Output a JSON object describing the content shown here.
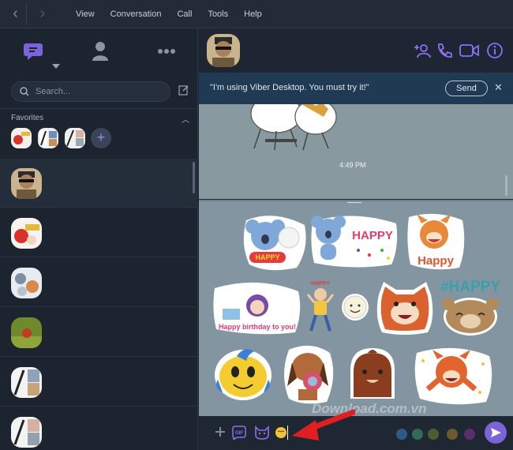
{
  "menu": [
    "View",
    "Conversation",
    "Call",
    "Tools",
    "Help"
  ],
  "sidebar": {
    "search": {
      "placeholder": "Search..."
    },
    "favorites_label": "Favorites",
    "fav_add_label": "+"
  },
  "banner": {
    "text": "\"I'm using Viber Desktop. You must try it!\"",
    "send_label": "Send",
    "close_label": "✕"
  },
  "messages": {
    "time": "4:49 PM"
  },
  "input_bar": {
    "gif_label": "GIF"
  },
  "stickers": [
    {
      "text": "HAPPY"
    },
    {
      "text": "HAPPY"
    },
    {
      "text": "Happy"
    },
    {
      "text": "Happy birthday to you!"
    },
    {
      "text": "HAPPY"
    },
    {
      "text": ""
    },
    {
      "text": ""
    },
    {
      "text": "#HAPPY"
    },
    {
      "text": ""
    },
    {
      "text": ""
    },
    {
      "text": ""
    },
    {
      "text": ""
    }
  ],
  "watermark": "Download.com.vn",
  "colors": {
    "accent": "#7b63d9",
    "sidebar_bg": "#1c2430",
    "banner_bg": "#1f3a52",
    "sticker_bg": "#8495a2",
    "arrow": "#e02020"
  }
}
